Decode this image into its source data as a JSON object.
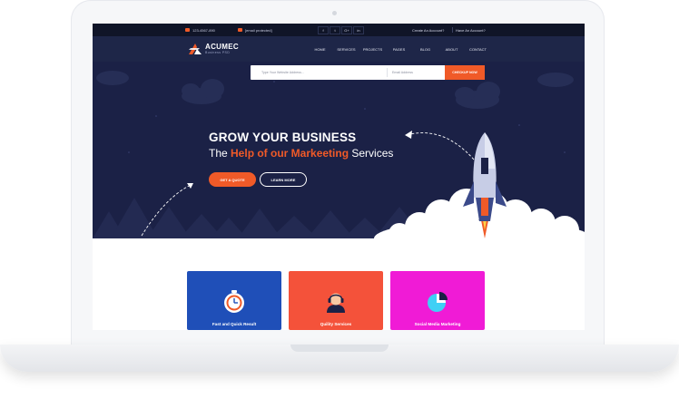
{
  "topbar": {
    "phone": "123-4567-890",
    "email": "[email protected]",
    "social": [
      "f",
      "t",
      "G+",
      "in"
    ],
    "create_account": "Create An Account?",
    "have_account": "Have An Account?"
  },
  "navbar": {
    "logo_name": "ACUMEC",
    "logo_sub": "Business PSD",
    "items": [
      "HOME",
      "SERVICES",
      "PROJECTS",
      "PAGES",
      "BLOG",
      "ABOUT",
      "CONTACT"
    ]
  },
  "search": {
    "website_placeholder": "Type Your Website Address...",
    "email_placeholder": "Email Address",
    "button": "CHECKUP NOW"
  },
  "hero": {
    "title": "GROW YOUR BUSINESS",
    "subtitle_pre": "The ",
    "subtitle_highlight": "Help of our Markeeting",
    "subtitle_post": " Services",
    "primary_button": "GET A QUOTE",
    "secondary_button": "LEARN MORE"
  },
  "cards": [
    {
      "label": "Fast and Quick Result",
      "icon": "stopwatch-icon",
      "color": "#1f4fb8"
    },
    {
      "label": "Quility Services",
      "icon": "support-agent-icon",
      "color": "#f4523a"
    },
    {
      "label": "Social Media Marketing",
      "icon": "pie-chart-icon",
      "color": "#f01bd6"
    }
  ],
  "colors": {
    "accent": "#f05a28",
    "topbar": "#101528",
    "navbar": "#1e2648",
    "hero_bg": "#1b2146"
  }
}
